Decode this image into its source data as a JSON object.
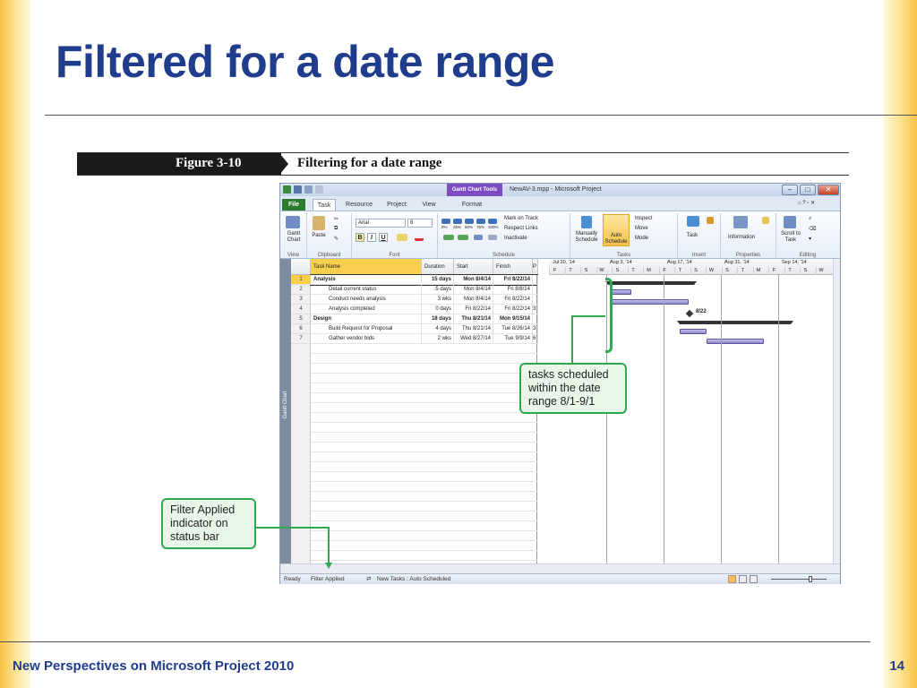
{
  "slide": {
    "title": "Filtered for a date range",
    "footer": "New Perspectives on Microsoft Project 2010",
    "page_number": "14"
  },
  "figure": {
    "number": "Figure 3-10",
    "caption": "Filtering for a date range"
  },
  "window": {
    "context_tab": "Gantt Chart Tools",
    "title": "NewAV-3.mpp - Microsoft Project",
    "tabs": [
      "File",
      "Task",
      "Resource",
      "Project",
      "View",
      "Format"
    ],
    "active_tab": "Task"
  },
  "ribbon": {
    "view": {
      "gantt_label": "Gantt Chart",
      "group": "View"
    },
    "clipboard": {
      "paste": "Paste",
      "group": "Clipboard"
    },
    "font": {
      "family": "Arial",
      "size": "8",
      "bold": "B",
      "italic": "I",
      "underline": "U",
      "group": "Font"
    },
    "schedule": {
      "mark_on_track": "Mark on Track",
      "respect_links": "Respect Links",
      "inactivate": "Inactivate",
      "percents": [
        "0%",
        "25%",
        "50%",
        "75%",
        "100%"
      ],
      "group": "Schedule"
    },
    "tasks": {
      "manually": "Manually Schedule",
      "auto": "Auto Schedule",
      "inspect": "Inspect",
      "move": "Move",
      "mode": "Mode",
      "group": "Tasks"
    },
    "insert": {
      "task": "Task",
      "group": "Insert"
    },
    "properties": {
      "information": "Information",
      "group": "Properties"
    },
    "editing": {
      "scroll": "Scroll to Task",
      "group": "Editing"
    }
  },
  "sheet": {
    "side_label": "Gantt Chart",
    "columns": [
      "Task Name",
      "Duration",
      "Start",
      "Finish",
      "P"
    ],
    "rows": [
      {
        "id": "1",
        "name": "Analysis",
        "duration": "15 days",
        "start": "Mon 8/4/14",
        "finish": "Fri 8/22/14",
        "pred": "",
        "summary": true
      },
      {
        "id": "2",
        "name": "Detail current status",
        "duration": "5 days",
        "start": "Mon 8/4/14",
        "finish": "Fri 8/8/14",
        "pred": "",
        "summary": false
      },
      {
        "id": "3",
        "name": "Conduct needs analysis",
        "duration": "3 wks",
        "start": "Mon 8/4/14",
        "finish": "Fri 8/22/14",
        "pred": "",
        "summary": false
      },
      {
        "id": "4",
        "name": "Analysis completed",
        "duration": "0 days",
        "start": "Fri 8/22/14",
        "finish": "Fri 8/22/14",
        "pred": "3",
        "summary": false
      },
      {
        "id": "5",
        "name": "Design",
        "duration": "18 days",
        "start": "Thu 8/21/14",
        "finish": "Mon 9/15/14",
        "pred": "",
        "summary": true
      },
      {
        "id": "6",
        "name": "Build Request for Proposal",
        "duration": "4 days",
        "start": "Thu 8/21/14",
        "finish": "Tue 8/26/14",
        "pred": "3",
        "summary": false
      },
      {
        "id": "7",
        "name": "Gather vendor bids",
        "duration": "2 wks",
        "start": "Wed 8/27/14",
        "finish": "Tue 9/9/14",
        "pred": "6",
        "summary": false
      }
    ]
  },
  "timescale": {
    "weeks": [
      "Jul 20, '14",
      "Aug 3, '14",
      "Aug 17, '14",
      "Aug 31, '14",
      "Sep 14, '14"
    ],
    "days": [
      "F",
      "T",
      "S",
      "W",
      "S",
      "T",
      "M",
      "F",
      "T",
      "S",
      "W",
      "S",
      "T",
      "M",
      "F",
      "T",
      "S",
      "W"
    ],
    "milestone_label": "8/22"
  },
  "status_bar": {
    "ready": "Ready",
    "filter": "Filter Applied",
    "new_tasks": "New Tasks : Auto Scheduled"
  },
  "callouts": {
    "tasks": "tasks scheduled within the date range 8/1-9/1",
    "filter": "Filter Applied indicator on status bar"
  },
  "colors": {
    "title": "#1f3d8c",
    "callout_border": "#2fa84f",
    "task_bar": "#8d88cf",
    "selected_header": "#f8cf4c"
  }
}
